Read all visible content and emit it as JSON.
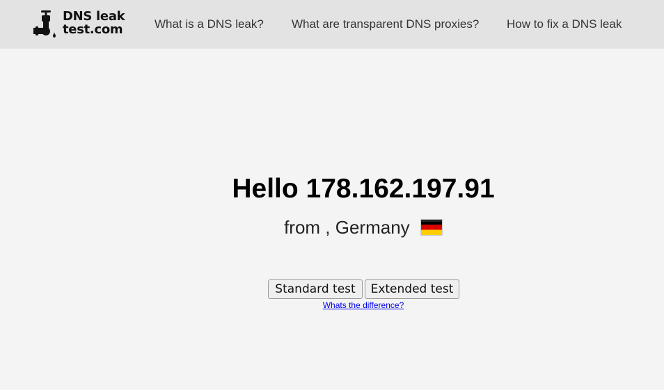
{
  "header": {
    "logo": {
      "line1": "DNS leak",
      "line2": "test.com",
      "icon": "faucet-icon"
    },
    "nav": [
      {
        "label": "What is a DNS leak?"
      },
      {
        "label": "What are transparent DNS proxies?"
      },
      {
        "label": "How to fix a DNS leak"
      }
    ]
  },
  "main": {
    "greeting": "Hello 178.162.197.91",
    "location": "from , Germany",
    "flag_icon": "germany-flag-icon",
    "buttons": {
      "standard": "Standard test",
      "extended": "Extended test"
    },
    "difference_link": "Whats the difference?"
  },
  "colors": {
    "header_bg": "#e3e3e3",
    "page_bg": "#f4f4f4",
    "link": "#0000ee",
    "flag": [
      "#000000",
      "#dd0000",
      "#ffce00"
    ]
  }
}
